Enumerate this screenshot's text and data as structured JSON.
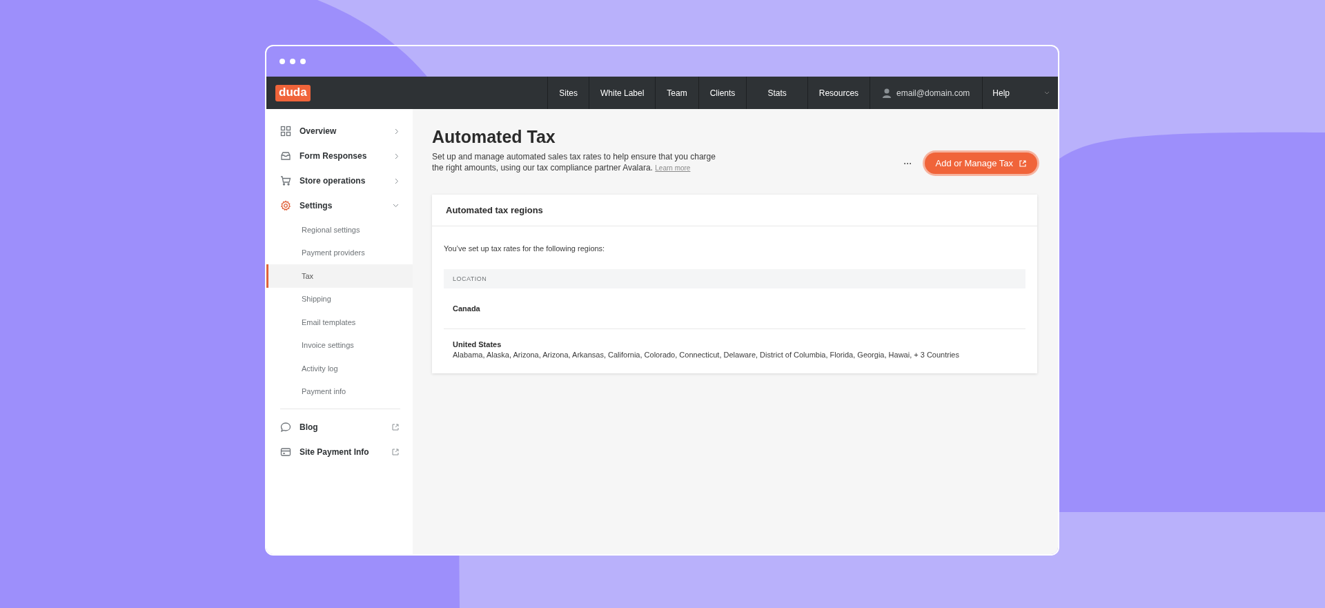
{
  "topbar": {
    "logo": "duda",
    "nav": [
      {
        "label": "Sites",
        "kind": "link"
      },
      {
        "label": "White Label",
        "kind": "link"
      },
      {
        "label": "Team",
        "kind": "link"
      },
      {
        "label": "Clients",
        "kind": "link"
      },
      {
        "label": "Stats",
        "kind": "link"
      },
      {
        "label": "Resources",
        "kind": "link"
      },
      {
        "label": "email@domain.com",
        "kind": "account"
      },
      {
        "label": "Help",
        "kind": "menu"
      }
    ]
  },
  "sidebar": {
    "items": [
      {
        "label": "Overview",
        "kind": "section",
        "selected": false,
        "expanded": false
      },
      {
        "label": "Form Responses",
        "kind": "section",
        "selected": false,
        "expanded": false
      },
      {
        "label": "Store operations",
        "kind": "section",
        "selected": false,
        "expanded": false
      },
      {
        "label": "Settings",
        "kind": "section",
        "selected": true,
        "expanded": true,
        "children": [
          {
            "label": "Regional settings",
            "selected": false
          },
          {
            "label": "Payment providers",
            "selected": false
          },
          {
            "label": "Tax",
            "selected": true
          },
          {
            "label": "Shipping",
            "selected": false
          },
          {
            "label": "Email templates",
            "selected": false
          },
          {
            "label": "Invoice settings",
            "selected": false
          },
          {
            "label": "Activity log",
            "selected": false
          },
          {
            "label": "Payment info",
            "selected": false
          }
        ]
      },
      {
        "label": "Blog",
        "kind": "external",
        "selected": false
      },
      {
        "label": "Site Payment Info",
        "kind": "external",
        "selected": false
      }
    ]
  },
  "header": {
    "title": "Automated Tax",
    "description": "Set up and manage automated sales tax rates to help ensure that you charge the right amounts, using our tax compliance partner Avalara.",
    "link": "Learn more",
    "more": "···",
    "button": "Add or Manage Tax"
  },
  "card": {
    "title": "Automated tax regions",
    "intro": "You’ve set up tax rates for the following regions:",
    "table": {
      "columns": [
        "LOCATION"
      ],
      "rows": [
        {
          "name": "Canada"
        },
        {
          "name": "United States",
          "detail": "Alabama, Alaska, Arizona, Arizona, Arkansas, California, Colorado, Connecticut, Delaware, District of Columbia, Florida, Georgia, Hawai, + 3 Countries"
        }
      ]
    }
  }
}
